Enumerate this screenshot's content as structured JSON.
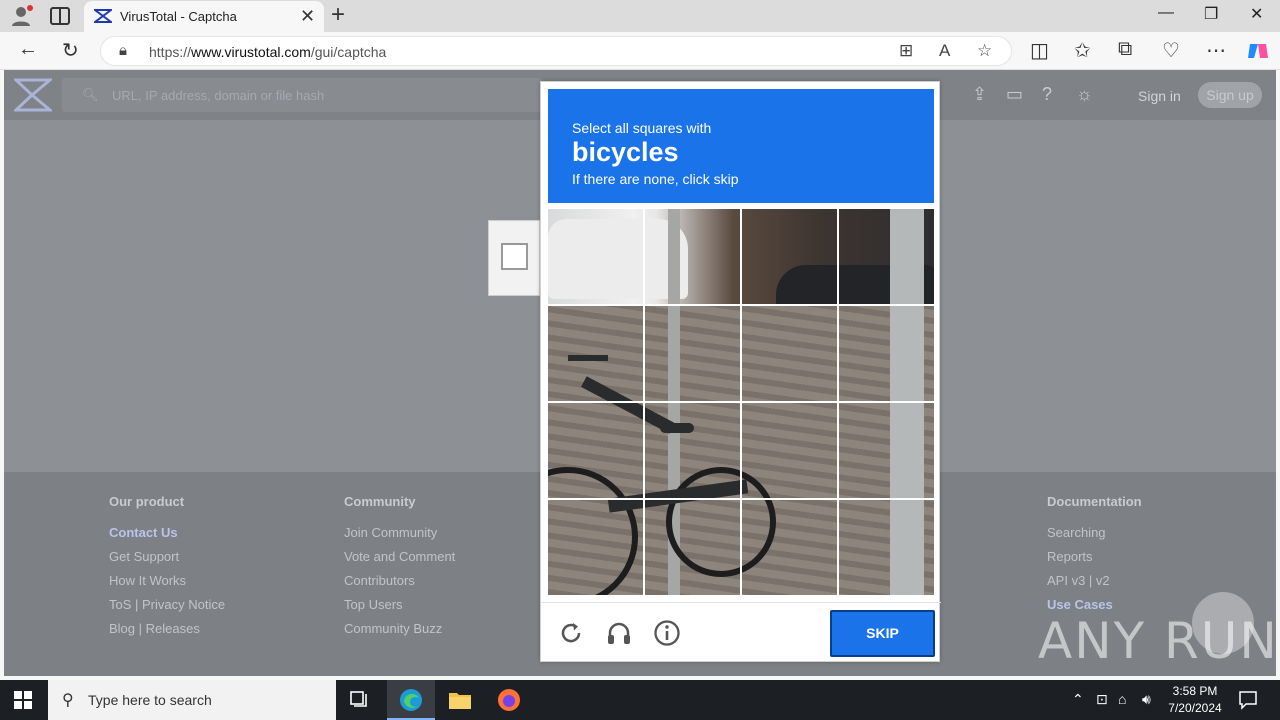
{
  "browser": {
    "tab_title": "VirusTotal - Captcha",
    "url_prefix": "https://",
    "url_domain": "www.virustotal.com",
    "url_path": "/gui/captcha",
    "new_tab_label": "+",
    "tab_close": "✕",
    "win_min": "—",
    "win_max": "❐",
    "win_close": "✕"
  },
  "vt": {
    "search_placeholder": "URL, IP address, domain or file hash",
    "sign_in": "Sign in",
    "sign_up": "Sign up",
    "footer": [
      {
        "heading": "Our product",
        "links": [
          "Contact Us",
          "Get Support",
          "How It Works",
          "ToS | Privacy Notice",
          "Blog | Releases"
        ],
        "highlight": 0
      },
      {
        "heading": "Community",
        "links": [
          "Join Community",
          "Vote and Comment",
          "Contributors",
          "Top Users",
          "Community Buzz"
        ],
        "highlight": -1
      },
      {
        "heading": "Documentation",
        "links": [
          "Searching",
          "Reports",
          "API v3 | v2",
          "Use Cases"
        ],
        "highlight": 3
      }
    ]
  },
  "captcha": {
    "instruction": "Select all squares with",
    "target": "bicycles",
    "hint": "If there are none, click skip",
    "skip_label": "SKIP"
  },
  "watermark": "ANY RUN",
  "taskbar": {
    "search_placeholder": "Type here to search",
    "time": "3:58 PM",
    "date": "7/20/2024"
  },
  "colors": {
    "captcha_blue": "#1a73e8",
    "taskbar": "#1c1f24"
  }
}
